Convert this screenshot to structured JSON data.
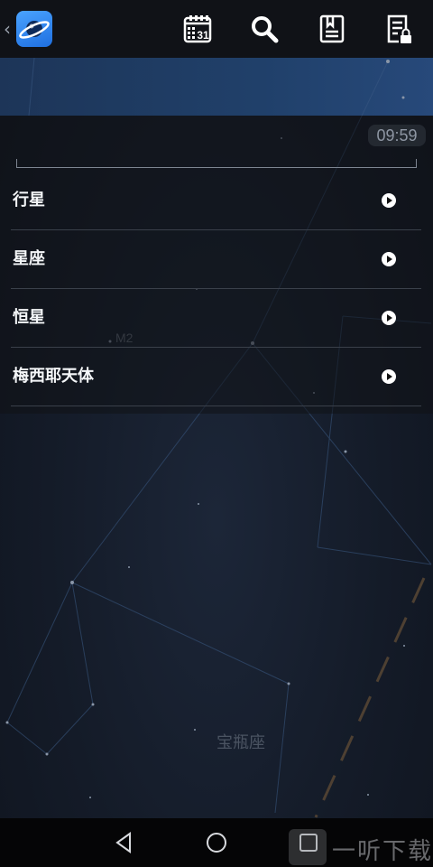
{
  "topbar": {
    "back_icon": "chevron-left-icon",
    "app_icon": "saturn-planet-icon",
    "actions": [
      {
        "icon": "calendar-icon",
        "text": "31"
      },
      {
        "icon": "search-icon"
      },
      {
        "icon": "bookmark-list-icon"
      },
      {
        "icon": "locked-document-icon"
      }
    ]
  },
  "time_badge": "09:59",
  "menu": {
    "items": [
      {
        "label": "行星"
      },
      {
        "label": "星座"
      },
      {
        "label": "恒星"
      },
      {
        "label": "梅西耶天体"
      }
    ]
  },
  "sky_labels": {
    "m2": "M2",
    "constellation": "宝瓶座"
  },
  "navbar": {
    "back": "triangle-back-icon",
    "home": "circle-home-icon",
    "recents": "square-recents-icon"
  },
  "watermark": {
    "text": "一听下载"
  },
  "colors": {
    "topbar_bg": "#101217",
    "sky_bg": "#141b28",
    "accent_blue": "#1f6fe0",
    "divider": "#3a404a"
  }
}
